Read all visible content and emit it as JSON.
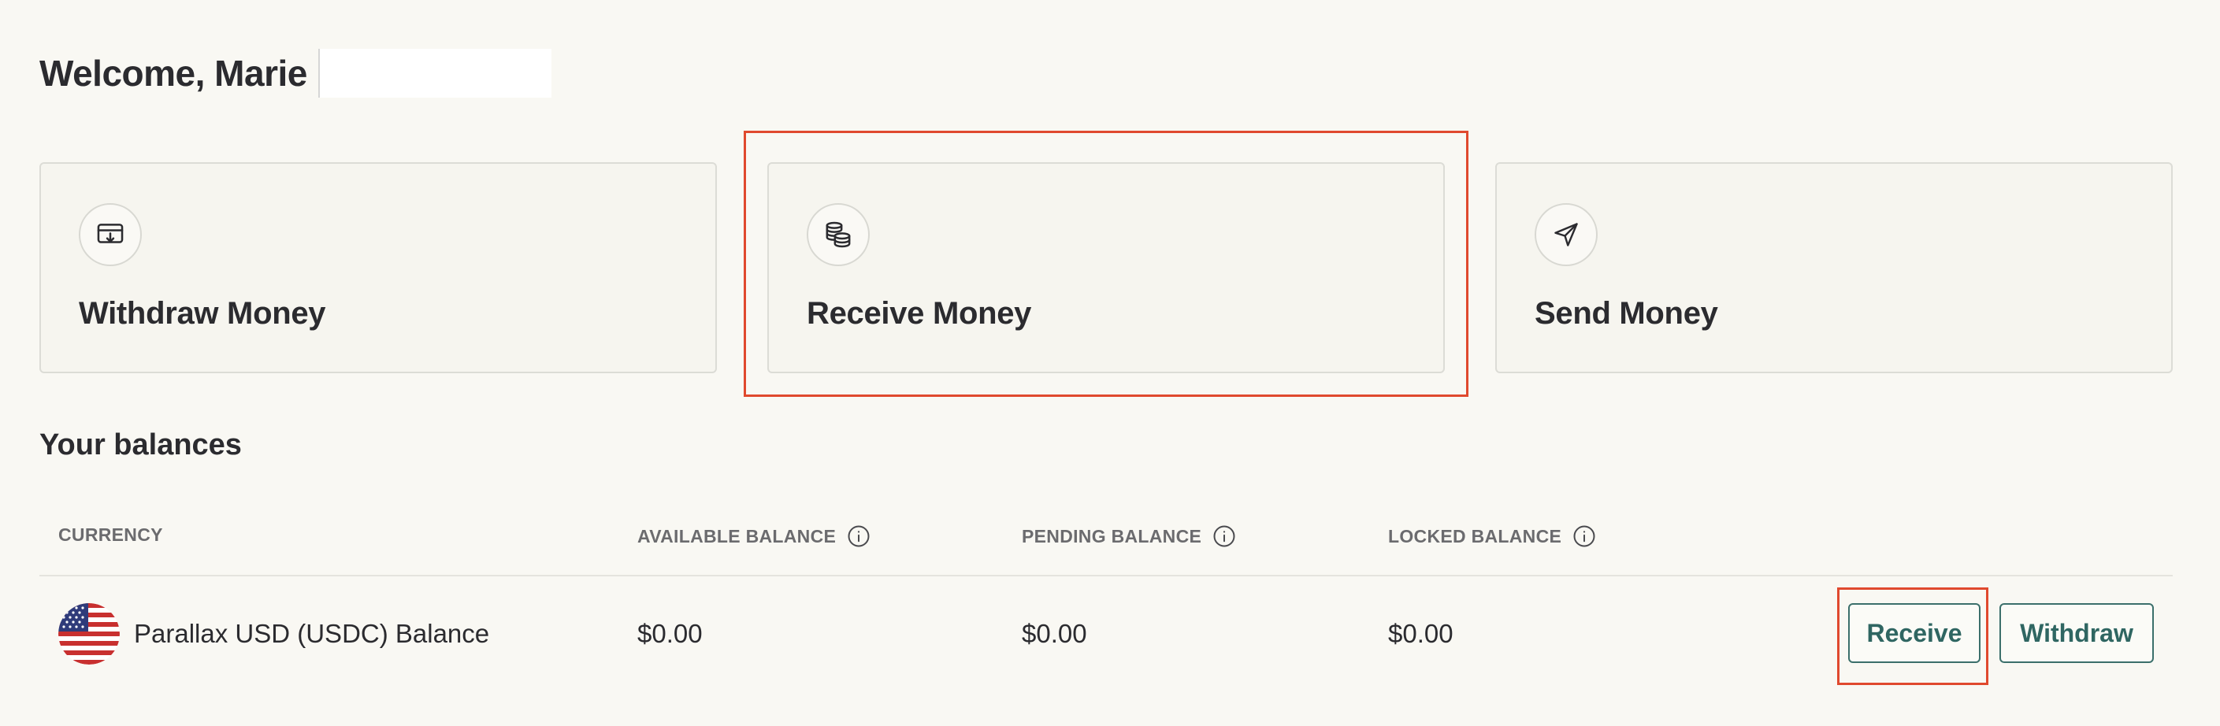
{
  "header": {
    "welcome_text": "Welcome, Marie"
  },
  "actions": [
    {
      "label": "Withdraw Money",
      "icon": "withdraw-icon"
    },
    {
      "label": "Receive Money",
      "icon": "coins-icon"
    },
    {
      "label": "Send Money",
      "icon": "send-icon"
    }
  ],
  "balances": {
    "title": "Your balances",
    "columns": [
      "CURRENCY",
      "AVAILABLE BALANCE",
      "PENDING BALANCE",
      "LOCKED BALANCE"
    ],
    "rows": [
      {
        "currency": "Parallax USD (USDC) Balance",
        "flag": "us-flag-icon",
        "available": "$0.00",
        "pending": "$0.00",
        "locked": "$0.00",
        "receive_label": "Receive",
        "withdraw_label": "Withdraw"
      }
    ]
  },
  "colors": {
    "background": "#f9f8f3",
    "accent": "#3b6f6b",
    "highlight": "#e0492e"
  }
}
